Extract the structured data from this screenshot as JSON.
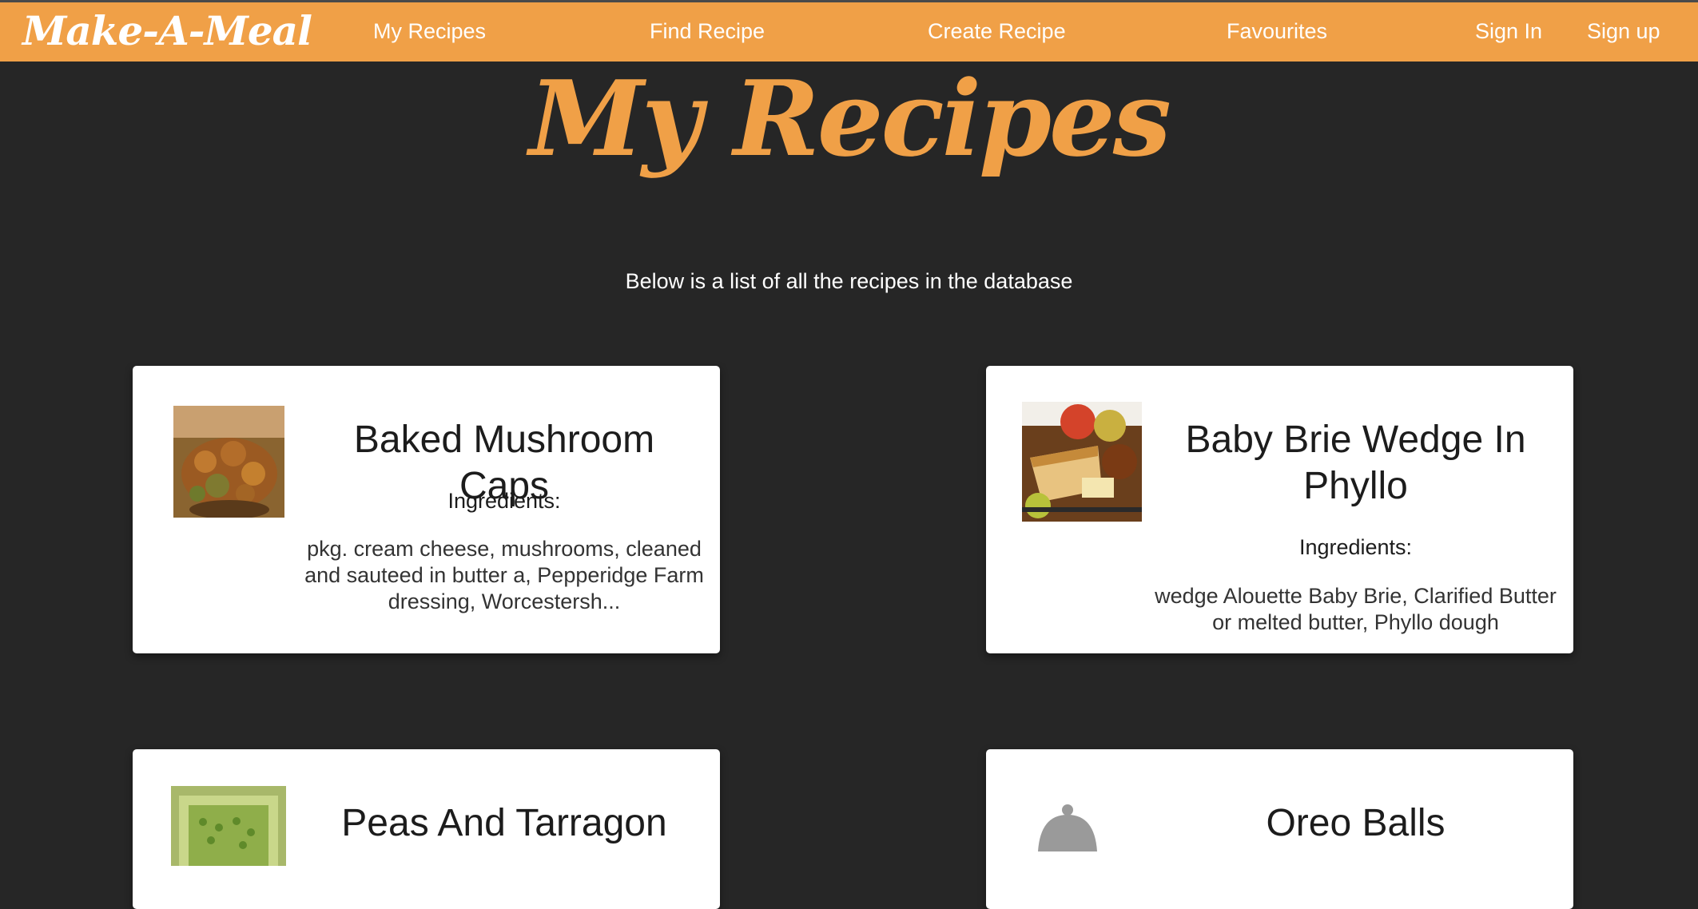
{
  "navbar": {
    "brand": "Make-A-Meal",
    "links": [
      "My Recipes",
      "Find Recipe",
      "Create Recipe",
      "Favourites"
    ],
    "sign_in": "Sign In",
    "sign_up": "Sign up"
  },
  "page": {
    "title": "My Recipes",
    "subtitle": "Below is a list of all the recipes in the database"
  },
  "recipes": [
    {
      "name": "Baked Mushroom Caps",
      "ingredients_label": "Ingredients:",
      "ingredients": "pkg. cream cheese, mushrooms, cleaned and sauteed in butter a, Pepperidge Farm dressing, Worcestersh..."
    },
    {
      "name": "Baby Brie Wedge In Phyllo",
      "ingredients_label": "Ingredients:",
      "ingredients": "wedge Alouette Baby Brie, Clarified Butter or melted butter, Phyllo dough"
    },
    {
      "name": "Peas And Tarragon"
    },
    {
      "name": "Oreo Balls"
    }
  ],
  "colors": {
    "accent": "#f0a047",
    "background": "#262626",
    "card": "#ffffff"
  }
}
